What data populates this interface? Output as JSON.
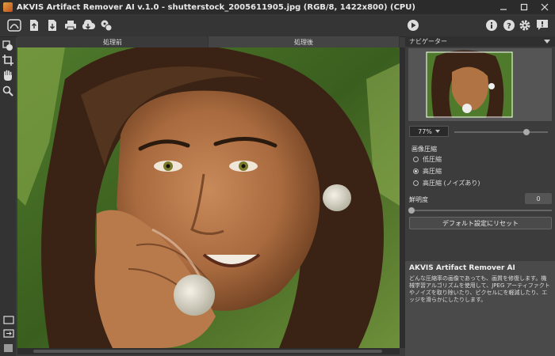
{
  "window": {
    "title": "AKVIS Artifact Remover AI v.1.0 - shutterstock_2005611905.jpg (RGB/8, 1422x800) (CPU)"
  },
  "toolbar": {
    "left_icons": [
      "home-icon",
      "open-icon",
      "save-icon",
      "print-icon",
      "share-icon",
      "plugins-icon"
    ],
    "run_icon": "play-icon",
    "right_icons": [
      "info-icon",
      "help-icon",
      "settings-icon",
      "notifications-icon"
    ]
  },
  "tools": [
    "before-after-icon",
    "crop-icon",
    "hand-icon",
    "zoom-icon"
  ],
  "tabs": {
    "before": "処理前",
    "after": "処理後"
  },
  "navigator": {
    "title": "ナビゲーター",
    "zoom": "77%",
    "zoom_fraction": 0.77
  },
  "compression": {
    "title": "画像圧縮",
    "options": [
      "低圧縮",
      "高圧縮",
      "高圧縮 (ノイズあり)"
    ],
    "selected_index": 1
  },
  "sharpness": {
    "label": "鮮明度",
    "value": "0"
  },
  "reset_label": "デフォルト設定にリセット",
  "info": {
    "title": "AKVIS Artifact Remover AI",
    "text": "どんな圧縮率の画像であっても、画質を修復します。機械学習アルゴリズムを使用して、JPEG アーティファクトやノイズを取り除いたり、ピクセルにを軽減したり、エッジを滑らかにしたりします。"
  },
  "colors": {
    "background": "#3c3c3c",
    "panel": "#4a4a4a",
    "titlebar": "#2b2b2b"
  }
}
